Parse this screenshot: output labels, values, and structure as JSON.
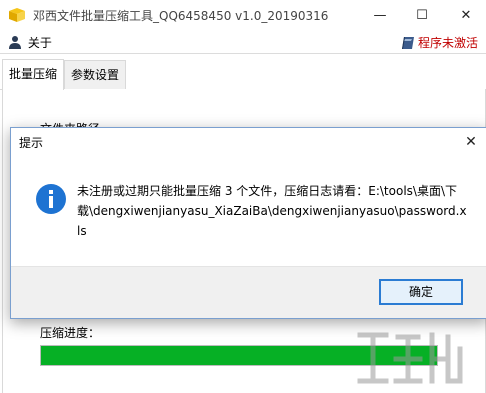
{
  "window": {
    "title": "邓西文件批量压缩工具_QQ6458450 v1.0_20190316",
    "minimize_glyph": "—",
    "maximize_glyph": "☐",
    "close_glyph": "✕"
  },
  "menu": {
    "about_label": "关于",
    "unactivated_label": "程序未激活"
  },
  "tabs": [
    {
      "label": "批量压缩",
      "active": true
    },
    {
      "label": "参数设置",
      "active": false
    }
  ],
  "main": {
    "file_path_label": "文件夹路径",
    "progress_label": "压缩进度：",
    "progress_percent": 100
  },
  "dialog": {
    "title": "提示",
    "close_glyph": "✕",
    "message": "未注册或过期只能批量压缩 3 个文件，压缩日志请看：E:\\tools\\桌面\\下载\\dengxiwenjianyasu_XiaZaiBa\\dengxiwenjianyasuo\\password.xls",
    "ok_label": "确定"
  },
  "colors": {
    "progress_fill": "#06b025",
    "unactivated_text": "#c00000",
    "info_icon": "#1e73d2",
    "ok_border": "#2b7cd3"
  },
  "icons": {
    "app": "box-icon",
    "about": "user-icon",
    "unactivated": "book-icon",
    "dialog": "info-icon"
  }
}
